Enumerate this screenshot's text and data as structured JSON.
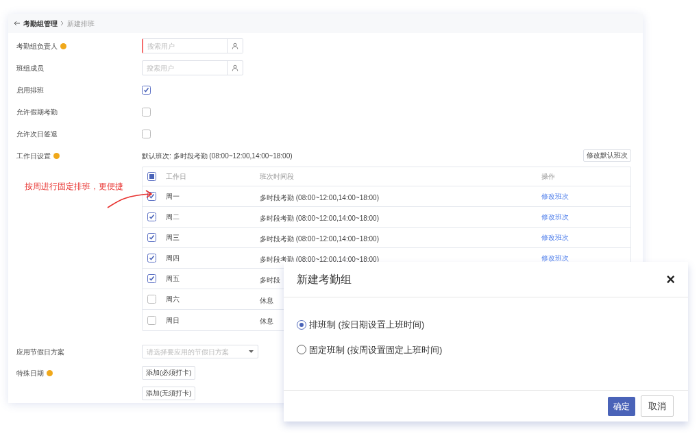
{
  "breadcrumb": {
    "parent": "考勤组管理",
    "current": "新建排班"
  },
  "form": [
    {
      "kind": "search",
      "label": "考勤组负责人",
      "info": true,
      "placeholder": "搜索用户",
      "required": true
    },
    {
      "kind": "search",
      "label": "班组成员",
      "info": false,
      "placeholder": "搜索用户",
      "required": false
    },
    {
      "kind": "checkbox",
      "label": "启用排班",
      "info": false,
      "checked": true
    },
    {
      "kind": "checkbox",
      "label": "允许假期考勤",
      "info": false,
      "checked": false
    },
    {
      "kind": "checkbox",
      "label": "允许次日签退",
      "info": false,
      "checked": false
    }
  ],
  "workday": {
    "label": "工作日设置",
    "info": true,
    "default_shift": "默认班次: 多时段考勤 (08:00~12:00,14:00~18:00)",
    "edit_default_button": "修改默认班次",
    "table": {
      "all_checked": true,
      "columns": [
        "工作日",
        "班次时间段",
        "操作"
      ],
      "rows": [
        {
          "day": "周一",
          "checked": true,
          "shift": "多时段考勤 (08:00~12:00,14:00~18:00)",
          "action": "修改班次"
        },
        {
          "day": "周二",
          "checked": true,
          "shift": "多时段考勤 (08:00~12:00,14:00~18:00)",
          "action": "修改班次"
        },
        {
          "day": "周三",
          "checked": true,
          "shift": "多时段考勤 (08:00~12:00,14:00~18:00)",
          "action": "修改班次"
        },
        {
          "day": "周四",
          "checked": true,
          "shift": "多时段考勤 (08:00~12:00,14:00~18:00)",
          "action": "修改班次"
        },
        {
          "day": "周五",
          "checked": true,
          "shift": "多时段"
        },
        {
          "day": "周六",
          "checked": false,
          "shift": "休息"
        },
        {
          "day": "周日",
          "checked": false,
          "shift": "休息"
        }
      ]
    }
  },
  "holiday": {
    "label": "应用节假日方案",
    "placeholder": "请选择要应用的节假日方案"
  },
  "special_dates": {
    "label": "特殊日期",
    "info": true,
    "buttons": [
      "添加(必须打卡)",
      "添加(无须打卡)"
    ]
  },
  "annotation": "按周进行固定排班，更便捷",
  "dialog": {
    "title": "新建考勤组",
    "close": "×",
    "options": [
      {
        "label": "排班制 (按日期设置上班时间)",
        "selected": true
      },
      {
        "label": "固定班制 (按周设置固定上班时间)",
        "selected": false
      }
    ],
    "buttons": [
      {
        "label": "确定",
        "kind": "primary"
      },
      {
        "label": "取消",
        "kind": "secondary"
      }
    ]
  }
}
